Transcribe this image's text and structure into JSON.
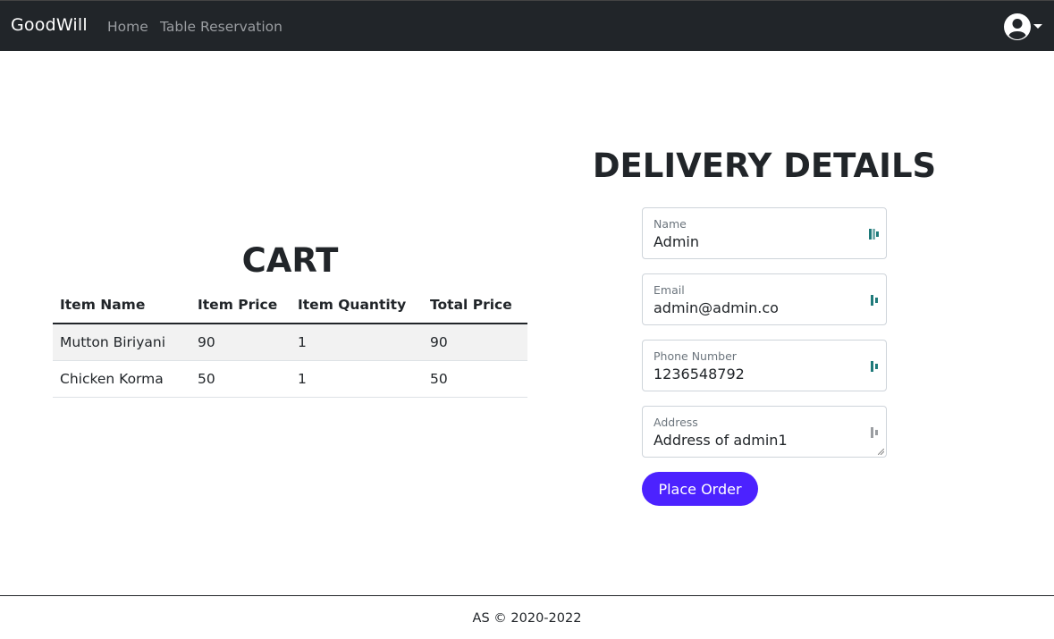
{
  "navbar": {
    "brand": "GoodWill",
    "links": [
      {
        "label": "Home"
      },
      {
        "label": "Table Reservation"
      }
    ],
    "user_icon": "user-circle-icon",
    "caret_icon": "caret-down-icon"
  },
  "cart": {
    "title": "CART",
    "columns": [
      "Item Name",
      "Item Price",
      "Item Quantity",
      "Total Price"
    ],
    "rows": [
      {
        "name": "Mutton Biriyani",
        "price": "90",
        "quantity": "1",
        "total": "90"
      },
      {
        "name": "Chicken Korma",
        "price": "50",
        "quantity": "1",
        "total": "50"
      }
    ]
  },
  "delivery": {
    "title": "DELIVERY DETAILS",
    "fields": {
      "name": {
        "label": "Name",
        "value": "Admin"
      },
      "email": {
        "label": "Email",
        "value": "admin@admin.co"
      },
      "phone": {
        "label": "Phone Number",
        "value": "1236548792"
      },
      "address": {
        "label": "Address",
        "value": "Address of admin1"
      }
    },
    "field_icon": "autofill-key-icon",
    "submit_label": "Place Order"
  },
  "footer": {
    "text": "AS © 2020-2022"
  },
  "colors": {
    "navbar_bg": "#212529",
    "button_bg": "#4c22ff",
    "field_icon": "#1f7a7a"
  }
}
